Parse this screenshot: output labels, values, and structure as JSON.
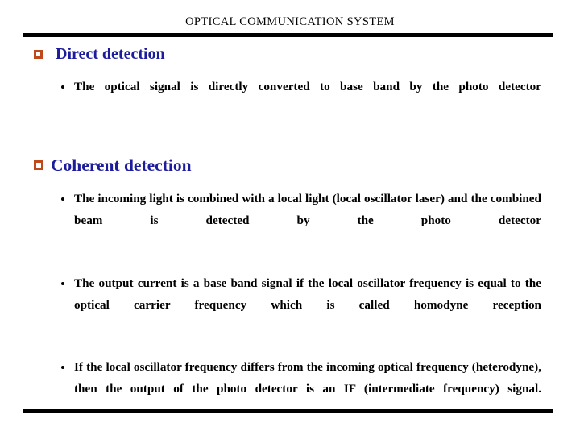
{
  "slide": {
    "title": "OPTICAL COMMUNICATION SYSTEM",
    "colors": {
      "heading": "#1C1C9C",
      "bullet_square": "#C0491C",
      "body_text": "#000000",
      "rule": "#000000",
      "background": "#FFFFFF"
    },
    "sections": [
      {
        "heading": "Direct detection",
        "bullets": [
          "The optical signal is directly converted to base band by the  photo detector"
        ]
      },
      {
        "heading": "Coherent detection",
        "bullets": [
          "The incoming light is combined with a local light (local oscillator laser) and the combined beam is detected by the photo detector",
          "The output current is a base band signal if the local oscillator frequency is equal to the optical carrier frequency which is called homodyne reception",
          "If the local oscillator frequency differs from the incoming optical frequency (heterodyne), then the output of the photo detector is an IF (intermediate frequency) signal."
        ]
      }
    ]
  }
}
